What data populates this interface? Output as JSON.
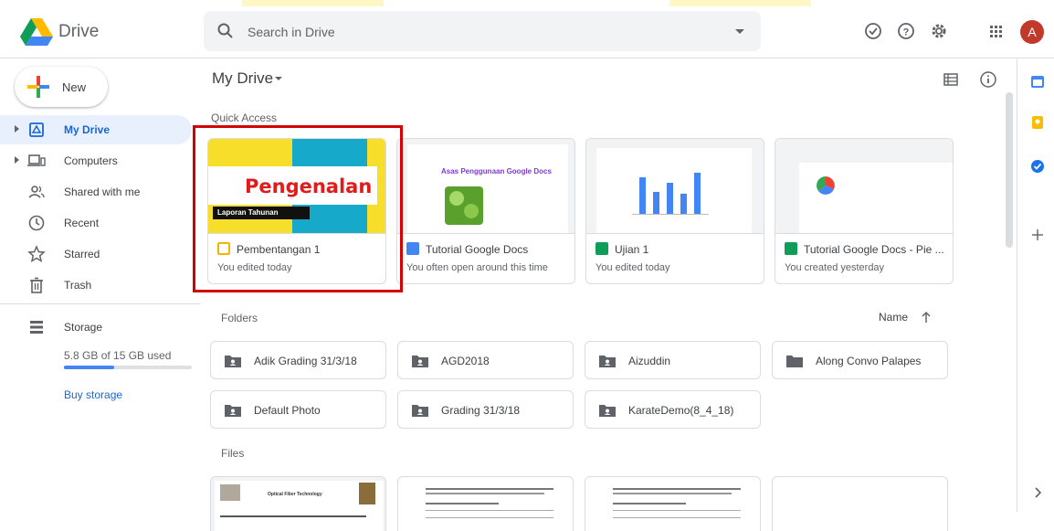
{
  "app": {
    "name": "Drive"
  },
  "search": {
    "placeholder": "Search in Drive"
  },
  "header": {
    "avatar_initial": "A"
  },
  "sidebar": {
    "new_label": "New",
    "items": [
      {
        "label": "My Drive"
      },
      {
        "label": "Computers"
      },
      {
        "label": "Shared with me"
      },
      {
        "label": "Recent"
      },
      {
        "label": "Starred"
      },
      {
        "label": "Trash"
      }
    ],
    "storage": {
      "label": "Storage",
      "used_text": "5.8 GB of 15 GB used",
      "used_fraction": 0.39,
      "buy_label": "Buy storage"
    }
  },
  "main": {
    "title": "My Drive",
    "quick_access_title": "Quick Access",
    "quick_access": [
      {
        "name": "Pembentangan 1",
        "sub": "You edited today",
        "type": "slides",
        "type_color": "#f4b400",
        "thumb_title": "Pengenalan",
        "thumb_caption": "Laporan Tahunan"
      },
      {
        "name": "Tutorial Google Docs",
        "sub": "You often open around this time",
        "type": "docs",
        "type_color": "#4285f4",
        "thumb_title": "Asas Penggunaan Google Docs"
      },
      {
        "name": "Ujian 1",
        "sub": "You edited today",
        "type": "sheets",
        "type_color": "#0f9d58"
      },
      {
        "name": "Tutorial Google Docs - Pie ...",
        "sub": "You created yesterday",
        "type": "sheets",
        "type_color": "#0f9d58"
      }
    ],
    "folders_title": "Folders",
    "sort_label": "Name",
    "folders": [
      {
        "name": "Adik Grading 31/3/18",
        "shared": true
      },
      {
        "name": "AGD2018",
        "shared": true
      },
      {
        "name": "Aizuddin",
        "shared": true
      },
      {
        "name": "Along Convo Palapes",
        "shared": false
      },
      {
        "name": "Default Photo",
        "shared": true
      },
      {
        "name": "Grading 31/3/18",
        "shared": true
      },
      {
        "name": "KarateDemo(8_4_18)",
        "shared": true
      }
    ],
    "files_title": "Files",
    "files_thumb_text": "Optical Fiber Technology"
  },
  "colors": {
    "accent": "#1967d2",
    "highlight_box": "#d40000"
  }
}
